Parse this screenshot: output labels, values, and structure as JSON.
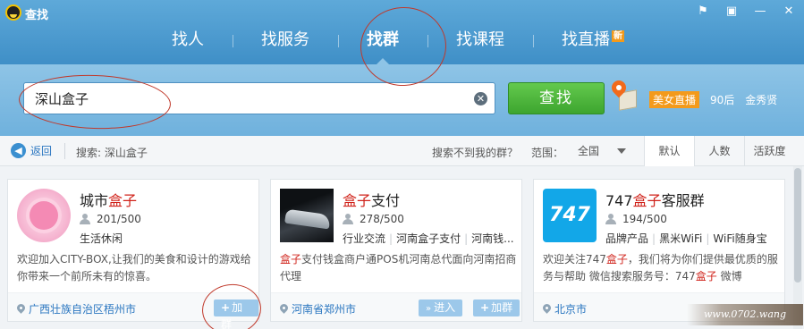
{
  "window": {
    "title": "查找",
    "controls": [
      "feedback-icon",
      "skin-icon",
      "minimize-icon",
      "close-icon"
    ]
  },
  "tabs": [
    {
      "label": "找人",
      "active": false
    },
    {
      "label": "找服务",
      "active": false
    },
    {
      "label": "找群",
      "active": true
    },
    {
      "label": "找课程",
      "active": false
    },
    {
      "label": "找直播",
      "active": false,
      "badge": "新"
    }
  ],
  "search": {
    "value": "深山盒子",
    "button": "查找"
  },
  "hot_links": [
    "美女直播",
    "90后",
    "金秀贤"
  ],
  "filter": {
    "back_label": "返回",
    "crumb": "搜索: 深山盒子",
    "cant_find": "搜索不到我的群？",
    "range_label": "范围：",
    "range_value": "全国",
    "sort_tabs": [
      {
        "label": "默认",
        "active": true
      },
      {
        "label": "人数",
        "active": false
      },
      {
        "label": "活跃度",
        "active": false
      }
    ]
  },
  "groups": [
    {
      "name_prefix": "城市",
      "name_highlight": "盒子",
      "name_suffix": "",
      "members": "201/500",
      "tags": [
        "生活休闲"
      ],
      "desc": "欢迎加入CITY-BOX,让我们的美食和设计的游戏给你带来一个前所未有的惊喜。",
      "location": "广西壮族自治区梧州市",
      "buttons": [
        "加群"
      ]
    },
    {
      "name_prefix": "",
      "name_highlight": "盒子",
      "name_suffix": "支付",
      "members": "278/500",
      "tags": [
        "行业交流",
        "河南盒子支付",
        "河南钱..."
      ],
      "desc_highlight": "盒子",
      "desc": "支付钱盒商户通POS机河南总代面向河南招商代理",
      "location": "河南省郑州市",
      "buttons": [
        "进入",
        "加群"
      ]
    },
    {
      "name_prefix": "747",
      "name_highlight": "盒子",
      "name_suffix": "客服群",
      "members": "194/500",
      "tags": [
        "品牌产品",
        "黑米WiFi",
        "WiFi随身宝"
      ],
      "desc_pre": "欢迎关注747",
      "desc_highlight": "盒子",
      "desc_mid": "，我们将为你们提供最优质的服务与帮助 微信搜索服务号：747",
      "desc_highlight2": "盒子",
      "desc_post": " 微博",
      "location": "北京市",
      "thumb_text": "747"
    }
  ],
  "watermark": "www.0702.wang"
}
